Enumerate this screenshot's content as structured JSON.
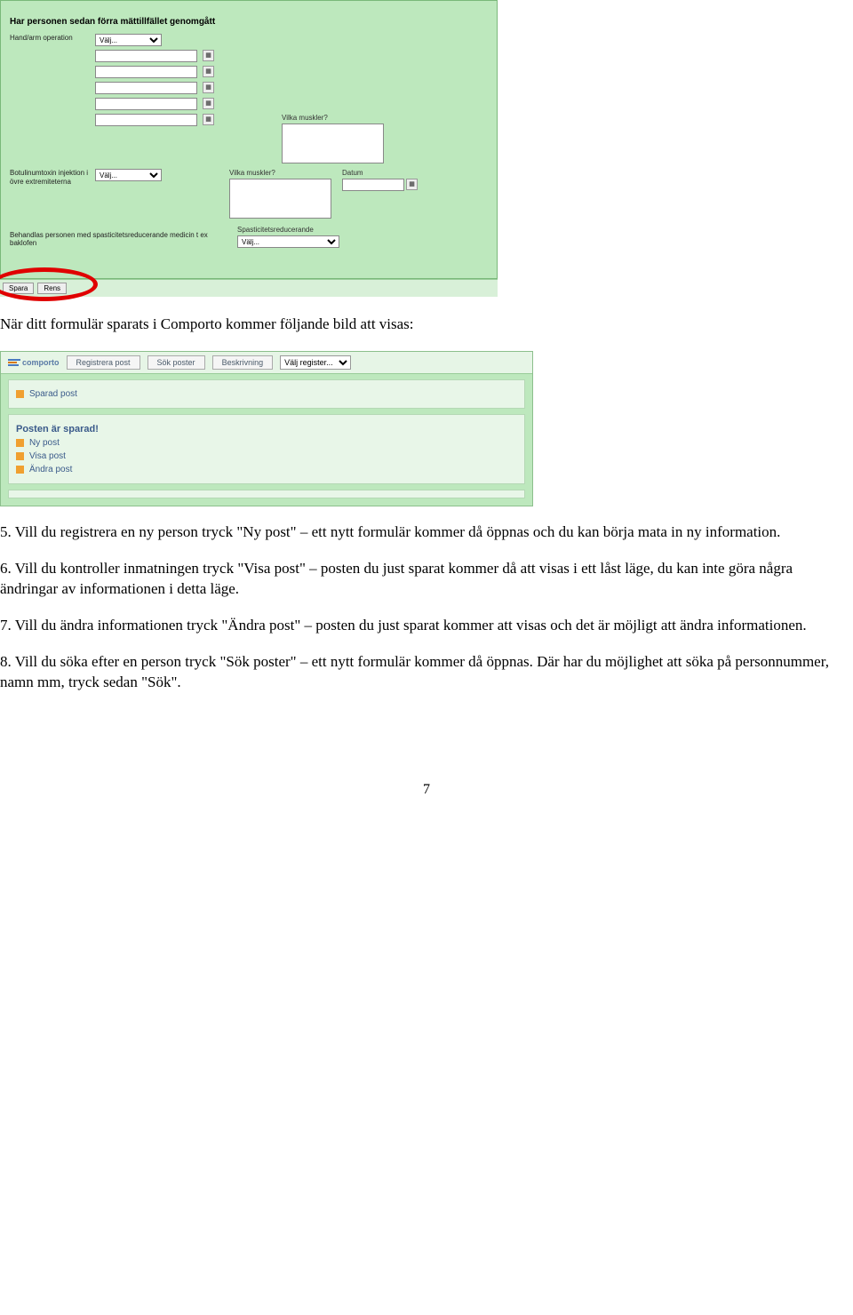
{
  "shot1": {
    "section_title": "Har personen sedan förra mättillfället genomgått",
    "row1_label": "Hand/arm operation",
    "select_placeholder": "Välj...",
    "muscles_label": "Vilka muskler?",
    "botox_label": "Botulinumtoxin injektion i övre extremiteterna",
    "date_label": "Datum",
    "baklofen_label": "Behandlas personen med spasticitetsreducerande medicin t ex baklofen",
    "spast_select_label": "Spasticitetsreducerande",
    "btn_spara": "Spara",
    "btn_rensa": "Rens"
  },
  "doc": {
    "para_intro": "När ditt formulär sparats i Comporto kommer följande bild att visas:",
    "p5": "5. Vill du registrera en ny person tryck \"Ny post\" – ett nytt formulär kommer då öppnas och du kan börja mata in ny information.",
    "p6": "6. Vill du kontroller inmatningen tryck \"Visa post\" – posten du just sparat kommer då att visas i ett låst läge, du kan inte göra några ändringar av informationen i detta läge.",
    "p7": "7. Vill du ändra informationen tryck \"Ändra post\" – posten du just sparat kommer att visas och det är möjligt att ändra informationen.",
    "p8": "8. Vill du söka efter en person tryck \"Sök poster\" – ett nytt formulär kommer då öppnas. Där har du möjlighet att söka på personnummer, namn mm, tryck sedan \"Sök\".",
    "page_number": "7"
  },
  "shot2": {
    "logo": "comporto",
    "tab_registrera": "Registrera post",
    "tab_sok": "Sök poster",
    "tab_beskr": "Beskrivning",
    "reg_placeholder": "Välj register...",
    "sparad_post": "Sparad post",
    "posten_sparad": "Posten är sparad!",
    "ny_post": "Ny post",
    "visa_post": "Visa post",
    "andra_post": "Ändra post"
  }
}
